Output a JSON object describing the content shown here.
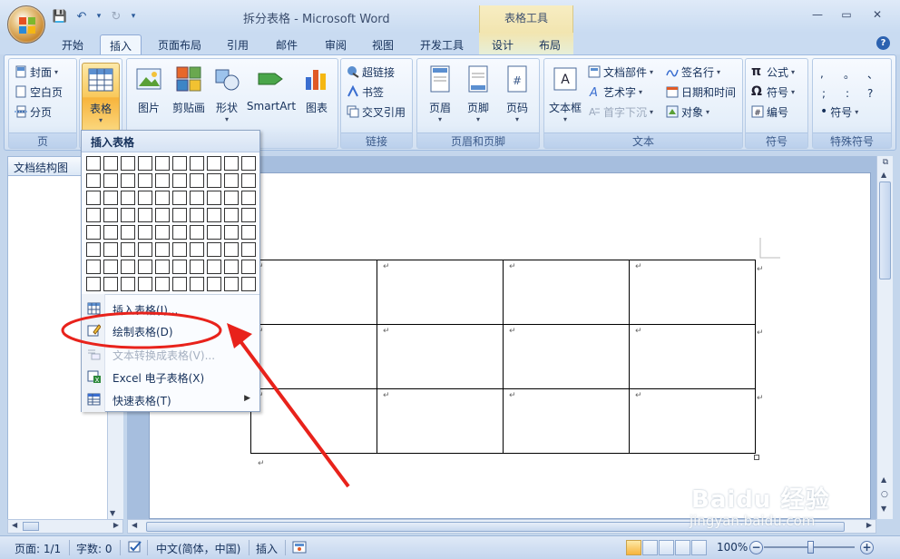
{
  "window": {
    "title": "拆分表格 - Microsoft Word",
    "context_tab_group": "表格工具",
    "help": "?"
  },
  "qat": {
    "save": "💾",
    "undo": "↶",
    "undo_caret": "▾",
    "redo": "↻",
    "customize": "▾"
  },
  "win_controls": {
    "minimize": "—",
    "maximize": "▭",
    "close": "✕"
  },
  "tabs": [
    {
      "label": "开始"
    },
    {
      "label": "插入"
    },
    {
      "label": "页面布局"
    },
    {
      "label": "引用"
    },
    {
      "label": "邮件"
    },
    {
      "label": "审阅"
    },
    {
      "label": "视图"
    },
    {
      "label": "开发工具"
    },
    {
      "label": "设计"
    },
    {
      "label": "布局"
    }
  ],
  "ribbon": {
    "pages": {
      "label": "页",
      "cover": "封面",
      "blank": "空白页",
      "break": "分页"
    },
    "table": {
      "label": "表格"
    },
    "illustrations": {
      "picture": "图片",
      "clipart": "剪贴画",
      "shapes": "形状",
      "smartart": "SmartArt",
      "chart": "图表"
    },
    "links": {
      "label": "链接",
      "hyperlink": "超链接",
      "bookmark": "书签",
      "crossref": "交叉引用"
    },
    "header_footer": {
      "label": "页眉和页脚",
      "header": "页眉",
      "footer": "页脚",
      "page_number": "页码"
    },
    "text": {
      "label": "文本",
      "textbox": "文本框",
      "quickparts": "文档部件",
      "wordart": "艺术字",
      "dropcap": "首字下沉",
      "signature": "签名行",
      "datetime": "日期和时间",
      "object": "对象"
    },
    "symbols": {
      "label": "符号",
      "equation": "公式",
      "symbol": "符号",
      "number": "编号"
    },
    "special": {
      "label": "特殊符号",
      "marks": [
        ",",
        "。",
        "、",
        ";",
        ":",
        "?"
      ],
      "symbol": "符号"
    }
  },
  "docmap": {
    "title": "文档结构图"
  },
  "table_menu": {
    "header": "插入表格",
    "items": {
      "insert_table": "插入表格(I)...",
      "draw_table": "绘制表格(D)",
      "text_to_table": "文本转换成表格(V)...",
      "excel": "Excel 电子表格(X)",
      "quick_tables": "快速表格(T)"
    }
  },
  "table_marker": "↵",
  "watermark": {
    "brand": "Baidu 经验",
    "url": "jingyan.baidu.com"
  },
  "status": {
    "page": "页面: 1/1",
    "words": "字数: 0",
    "language": "中文(简体，中国)",
    "mode": "插入",
    "zoom": "100%",
    "zoom_minus": "−",
    "zoom_plus": "+"
  },
  "colors": {
    "annotation_red": "#e8221b",
    "ribbon_active": "#f7b43c"
  }
}
